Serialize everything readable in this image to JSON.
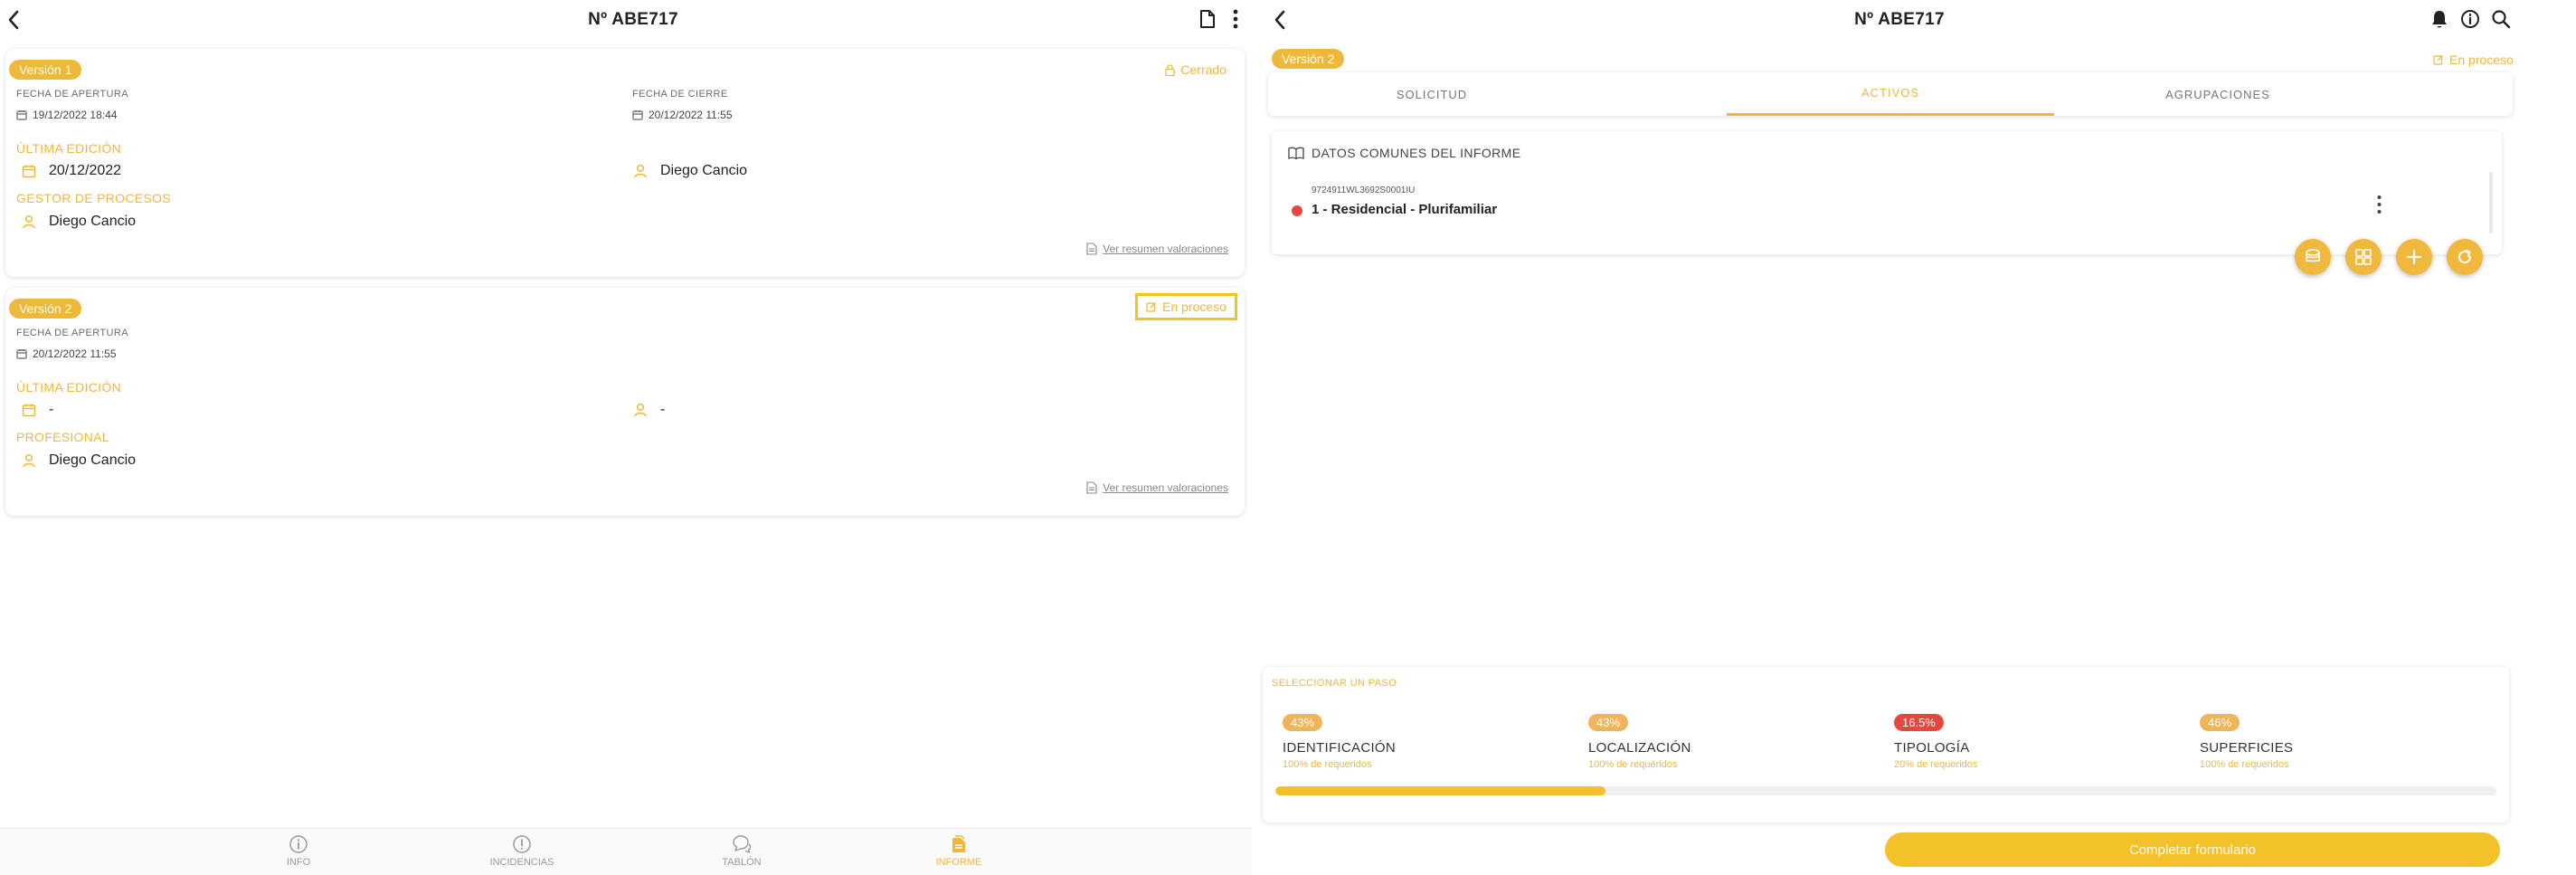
{
  "left": {
    "header": {
      "title": "Nº ABE717"
    },
    "version1": {
      "badge": "Versión 1",
      "status": "Cerrado",
      "opening_label": "FECHA DE APERTURA",
      "opening_value": "19/12/2022 18:44",
      "closing_label": "FECHA DE CIERRE",
      "closing_value": "20/12/2022 11:55",
      "last_edit_label": "ÚLTIMA EDICIÓN",
      "last_edit_date": "20/12/2022",
      "last_edit_user": "Diego Cancio",
      "role_label": "GESTOR DE PROCESOS",
      "role_user": "Diego Cancio",
      "link": "Ver resumen valoraciones"
    },
    "version2": {
      "badge": "Versión 2",
      "status": "En proceso",
      "opening_label": "FECHA DE APERTURA",
      "opening_value": "20/12/2022 11:55",
      "last_edit_label": "ÚLTIMA EDICIÓN",
      "last_edit_date": "-",
      "last_edit_user": "-",
      "role_label": "PROFESIONAL",
      "role_user": "Diego Cancio",
      "link": "Ver resumen valoraciones"
    },
    "bottom_nav": [
      {
        "label": "INFO",
        "icon": "info-icon"
      },
      {
        "label": "INCIDENCIAS",
        "icon": "alert-icon"
      },
      {
        "label": "TABLÓN",
        "icon": "chat-icon"
      },
      {
        "label": "INFORME",
        "icon": "report-icon",
        "active": true
      }
    ]
  },
  "right": {
    "header": {
      "title": "Nº ABE717"
    },
    "version_badge": "Versión 2",
    "status": "En proceso",
    "tabs": [
      {
        "label": "SOLICITUD"
      },
      {
        "label": "ACTIVOS",
        "active": true
      },
      {
        "label": "AGRUPACIONES"
      }
    ],
    "common_data_label": "DATOS COMUNES DEL INFORME",
    "asset": {
      "ref": "9724911WL3692S0001IU",
      "name": "1 - Residencial - Plurifamiliar"
    },
    "steps_title": "SELECCIONAR UN PASO",
    "steps": [
      {
        "pct": "43%",
        "title": "IDENTIFICACIÓN",
        "sub": "100% de requeridos",
        "color": "#f0b45a"
      },
      {
        "pct": "43%",
        "title": "LOCALIZACIÓN",
        "sub": "100% de requeridos",
        "color": "#f0b45a"
      },
      {
        "pct": "16.5%",
        "title": "TIPOLOGÍA",
        "sub": "20% de requeridos",
        "color": "#e5473f"
      },
      {
        "pct": "46%",
        "title": "SUPERFICIES",
        "sub": "100% de requeridos",
        "color": "#f0b45a"
      }
    ],
    "progress": 0.27,
    "complete_button": "Completar formulario"
  },
  "colors": {
    "accent": "#eeb83a",
    "danger": "#e5473f"
  }
}
